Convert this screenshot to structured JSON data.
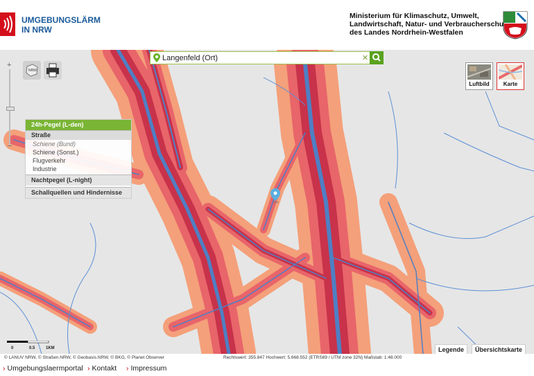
{
  "header": {
    "logo_line1": "UMGEBUNGSLÄRM",
    "logo_line2": "IN NRW",
    "ministry_line1": "Ministerium für Klimaschutz, Umwelt,",
    "ministry_line2": "Landwirtschaft, Natur- und Verbraucherschutz",
    "ministry_line3": "des Landes Nordrhein-Westfalen"
  },
  "colors": {
    "brand_red": "#d40f1b",
    "brand_blue": "#1a5a9a",
    "accent_green": "#7ab535",
    "noise_high": "#c8324a",
    "noise_mid": "#e8656a",
    "noise_low": "#f4a07a",
    "road": "#4f7fc4",
    "map_bg": "#e6e6e6"
  },
  "search": {
    "value": "Langenfeld (Ort)",
    "clear_icon": "close-icon",
    "button_icon": "search-icon"
  },
  "toolbar": {
    "nrw_label": "NRW",
    "print_icon": "printer-icon"
  },
  "layer_panel": {
    "header": "24h-Pegel (L-den)",
    "selected": "Straße",
    "items": [
      "Schiene (Bund)",
      "Schiene (Sonst.)",
      "Flugverkehr",
      "Industrie"
    ],
    "section_night": "Nachtpegel (L-night)",
    "section_sources": "Schallquellen und Hindernisse"
  },
  "view_switch": {
    "luftbild": "Luftbild",
    "karte": "Karte",
    "active": "Karte"
  },
  "scale": {
    "labels": [
      "0",
      "0.5",
      "1KM"
    ]
  },
  "map_buttons": {
    "legend": "Legende",
    "overview": "Übersichtskarte"
  },
  "status": {
    "copyright": "© LANUV NRW, © Straßen.NRW, © Geobasis.NRW, © BKG, © Planet Observer",
    "coords": "Rechtswert: 355.847 Hochwert: 5.668.552 (ETRS89 / UTM zone 32N)   Maßstab: 1:48.000"
  },
  "footer": {
    "links": [
      "Umgebungslaermportal",
      "Kontakt",
      "Impressum"
    ]
  }
}
